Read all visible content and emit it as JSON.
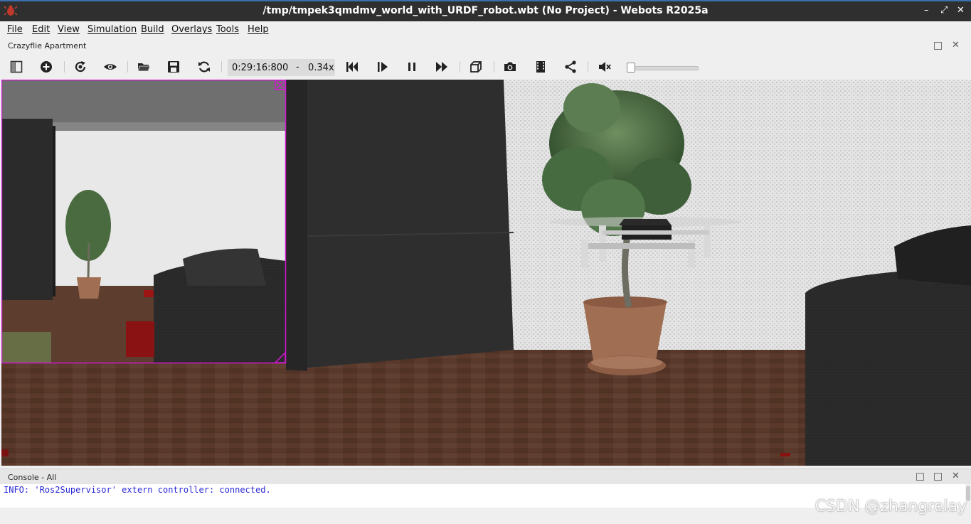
{
  "window": {
    "title": "/tmp/tmpek3qmdmv_world_with_URDF_robot.wbt (No Project) - Webots R2025a",
    "controls": {
      "minimize": "–",
      "maximize": "⤢",
      "close": "✕"
    }
  },
  "menu": [
    "File",
    "Edit",
    "View",
    "Simulation",
    "Build",
    "Overlays",
    "Tools",
    "Help"
  ],
  "scene_dock": {
    "label": "Crazyflie Apartment"
  },
  "toolbar": {
    "time": "0:29:16:800",
    "dash": "-",
    "speed": "0.34x",
    "volume_level": 0.0,
    "icons": [
      "toggle-scene-tree-icon",
      "add-node-icon",
      "reload-world-icon",
      "view-icon",
      "open-world-icon",
      "save-world-icon",
      "reset-simulation-icon",
      "step-back-icon",
      "step-icon",
      "pause-icon",
      "fast-forward-icon",
      "render-toggle-icon",
      "screenshot-icon",
      "record-movie-icon",
      "share-icon",
      "mute-icon"
    ]
  },
  "console": {
    "label": "Console - All",
    "lines": [
      "INFO: 'Ros2Supervisor' extern controller: connected."
    ]
  },
  "watermark": "CSDN @zhangrelay",
  "colors": {
    "overlay_border": "#d018d0",
    "console_text": "#2a2ad6",
    "titlebar": "#2f2f2f"
  }
}
